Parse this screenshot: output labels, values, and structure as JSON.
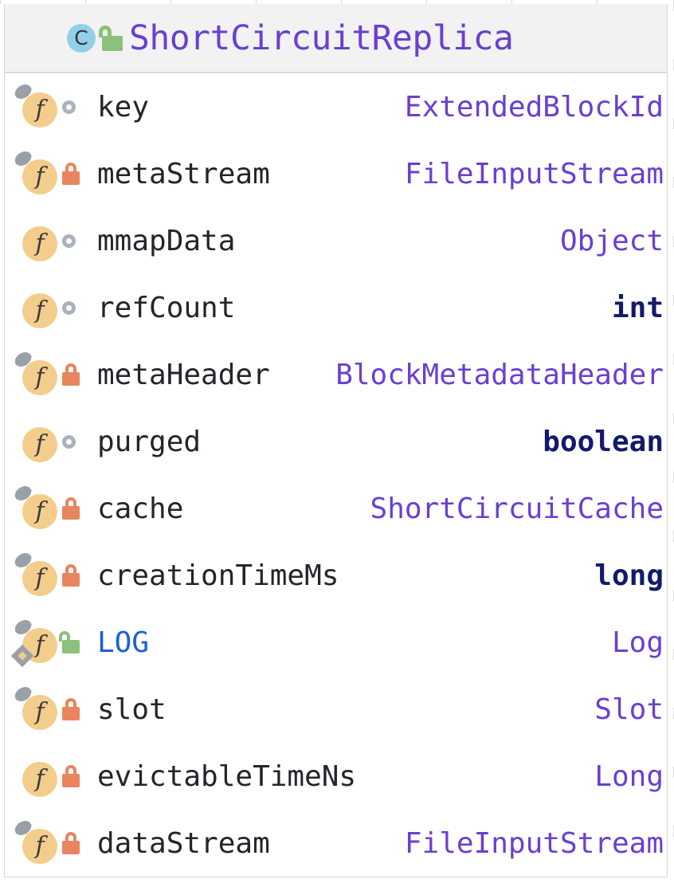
{
  "header": {
    "icon": "class-icon",
    "icon_letter": "C",
    "visibility_icon": "unlock-icon-green",
    "title": "ShortCircuitReplica"
  },
  "colors": {
    "class_name": "#6a3fd0",
    "type_reference": "#6a3fd0",
    "type_primitive": "#131a6b",
    "static_field_name": "#1d5fd6",
    "field_name": "#22262a",
    "field_icon_bg": "#f3cd8b",
    "class_icon_bg": "#92cfe8",
    "private_lock": "#e8855e",
    "public_lock": "#8cc07c",
    "package_private_ring": "#aab2bb",
    "modifier_marker": "#9aa0a6",
    "header_bg": "#f2f2f2",
    "panel_bg": "#ffffff",
    "border": "#d6d6d6"
  },
  "members": [
    {
      "icon": "field-icon",
      "icon_letter": "f",
      "final": true,
      "static": false,
      "visibility": "package-private",
      "visibility_icon": "ring-icon",
      "name": "key",
      "type": "ExtendedBlockId",
      "type_kind": "reference"
    },
    {
      "icon": "field-icon",
      "icon_letter": "f",
      "final": true,
      "static": false,
      "visibility": "private",
      "visibility_icon": "lock-icon-orange",
      "name": "metaStream",
      "type": "FileInputStream",
      "type_kind": "reference"
    },
    {
      "icon": "field-icon",
      "icon_letter": "f",
      "final": false,
      "static": false,
      "visibility": "package-private",
      "visibility_icon": "ring-icon",
      "name": "mmapData",
      "type": "Object",
      "type_kind": "reference"
    },
    {
      "icon": "field-icon",
      "icon_letter": "f",
      "final": false,
      "static": false,
      "visibility": "package-private",
      "visibility_icon": "ring-icon",
      "name": "refCount",
      "type": "int",
      "type_kind": "primitive"
    },
    {
      "icon": "field-icon",
      "icon_letter": "f",
      "final": true,
      "static": false,
      "visibility": "private",
      "visibility_icon": "lock-icon-orange",
      "name": "metaHeader",
      "type": "BlockMetadataHeader",
      "type_kind": "reference"
    },
    {
      "icon": "field-icon",
      "icon_letter": "f",
      "final": false,
      "static": false,
      "visibility": "package-private",
      "visibility_icon": "ring-icon",
      "name": "purged",
      "type": "boolean",
      "type_kind": "primitive"
    },
    {
      "icon": "field-icon",
      "icon_letter": "f",
      "final": true,
      "static": false,
      "visibility": "private",
      "visibility_icon": "lock-icon-orange",
      "name": "cache",
      "type": "ShortCircuitCache",
      "type_kind": "reference"
    },
    {
      "icon": "field-icon",
      "icon_letter": "f",
      "final": true,
      "static": false,
      "visibility": "private",
      "visibility_icon": "lock-icon-orange",
      "name": "creationTimeMs",
      "type": "long",
      "type_kind": "primitive"
    },
    {
      "icon": "field-icon",
      "icon_letter": "f",
      "final": true,
      "static": true,
      "visibility": "public",
      "visibility_icon": "unlock-icon-green",
      "name": "LOG",
      "type": "Log",
      "type_kind": "reference"
    },
    {
      "icon": "field-icon",
      "icon_letter": "f",
      "final": true,
      "static": false,
      "visibility": "private",
      "visibility_icon": "lock-icon-orange",
      "name": "slot",
      "type": "Slot",
      "type_kind": "reference"
    },
    {
      "icon": "field-icon",
      "icon_letter": "f",
      "final": false,
      "static": false,
      "visibility": "private",
      "visibility_icon": "lock-icon-orange",
      "name": "evictableTimeNs",
      "type": "Long",
      "type_kind": "reference"
    },
    {
      "icon": "field-icon",
      "icon_letter": "f",
      "final": true,
      "static": false,
      "visibility": "private",
      "visibility_icon": "lock-icon-orange",
      "name": "dataStream",
      "type": "FileInputStream",
      "type_kind": "reference"
    }
  ]
}
